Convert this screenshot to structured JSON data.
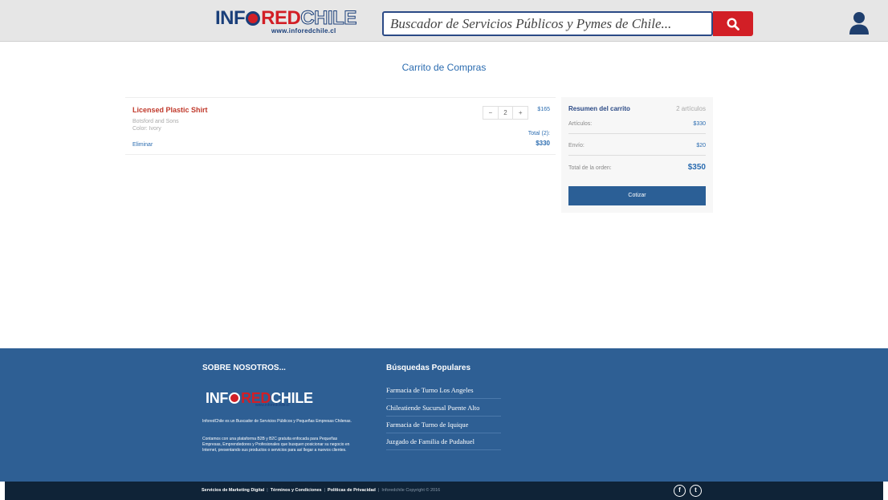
{
  "header": {
    "logo_part1": "INF",
    "logo_part2": "RED",
    "logo_part3": "CHILE",
    "logo_url": "www.inforedchile.cl",
    "search_placeholder": "Buscador de Servicios Públicos y Pymes de Chile..."
  },
  "main": {
    "title": "Carrito de Compras"
  },
  "cart": {
    "items": [
      {
        "name": "Licensed Plastic Shirt",
        "brand": "Botsford and Sons",
        "color": "Color: Ivory",
        "remove_label": "Eliminar",
        "qty_minus": "−",
        "qty": "2",
        "qty_plus": "+",
        "price": "$165",
        "total_label": "Total (2):",
        "total": "$330"
      }
    ]
  },
  "summary": {
    "title": "Resumen del carrito",
    "count": "2 artículos",
    "articles_label": "Artículos:",
    "articles_value": "$330",
    "shipping_label": "Envío:",
    "shipping_value": "$20",
    "total_label": "Total de la orden:",
    "total_value": "$350",
    "button_label": "Cotizar"
  },
  "footer": {
    "about_title": "SOBRE NOSOTROS...",
    "logo_part1": "INF",
    "logo_part2": "RED",
    "logo_part3": "CHILE",
    "logo_url": "www.inforedchile.cl",
    "about_p1": "InforedChile es un Buscador de Servicios Públicos y Pequeñas Empresas Chilenas.",
    "about_p2": "Contamos con una plataforma B2B y B2C gratuita enfocada para Pequeñas Empresas, Emprendedores y Profesionales que busquen posicionar su negocio en Internet, presentando sus productos o servicios para así llegar a nuevos clientes.",
    "popular_title": "Búsquedas Populares",
    "popular_links": [
      "Farmacia de Turno Los Angeles",
      "Chileatiende Sucursal Puente Alto",
      "Farmacia de Turno de Iquique",
      "Juzgado de Familia de Pudahuel"
    ]
  },
  "bottom_bar": {
    "link1": "Servicios de Marketing Digital",
    "link2": "Términos y Condiciones",
    "link3": "Políticas de Privacidad",
    "copyright": "Inforedchile Copyright © 2016",
    "separator": "|",
    "facebook_glyph": "f",
    "twitter_glyph": "t"
  },
  "colors": {
    "brand_blue": "#2e5f94",
    "brand_red": "#d21f26",
    "dark_bar": "#0f2337"
  }
}
